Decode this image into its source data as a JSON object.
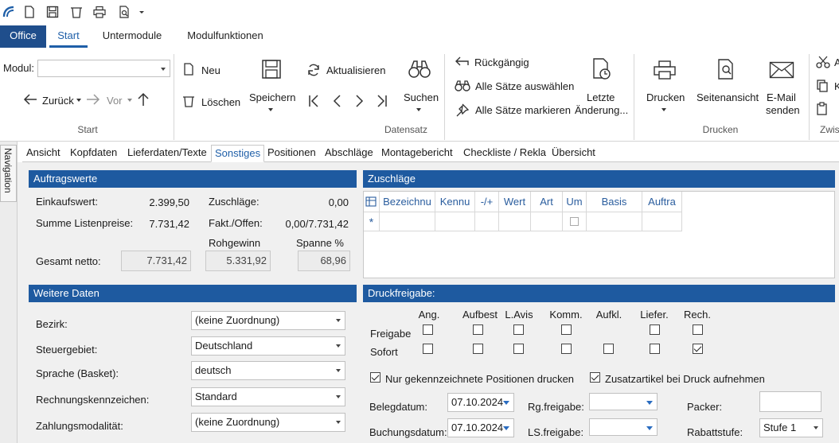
{
  "qat": {
    "icons": [
      "app-logo-icon",
      "new-document-icon",
      "save-icon",
      "delete-icon",
      "print-icon",
      "print-preview-icon",
      "dropdown-arrow-icon"
    ]
  },
  "tabs": {
    "office": "Office",
    "start": "Start",
    "untermodule": "Untermodule",
    "modulfunktionen": "Modulfunktionen"
  },
  "ribbon": {
    "modul_label": "Modul:",
    "zurueck": "Zurück",
    "vor": "Vor",
    "start_group": "Start",
    "neu": "Neu",
    "loeschen": "Löschen",
    "speichern": "Speichern",
    "aktualisieren": "Aktualisieren",
    "suchen": "Suchen",
    "rueckgaengig": "Rückgängig",
    "alle_auswaehlen": "Alle Sätze auswählen",
    "alle_markieren": "Alle Sätze markieren",
    "letzte_1": "Letzte",
    "letzte_2": "Änderung...",
    "datensatz_group": "Datensatz",
    "drucken": "Drucken",
    "seitenansicht": "Seitenansicht",
    "email_1": "E-Mail",
    "email_2": "senden",
    "drucken_group": "Drucken",
    "zwis_group": "Zwis",
    "cut_short": "A",
    "copy_short": "K"
  },
  "navigation": {
    "label": "Navigation"
  },
  "subtabs": [
    "Ansicht",
    "Kopfdaten",
    "Lieferdaten/Texte",
    "Sonstiges",
    "Positionen",
    "Abschläge",
    "Montagebericht",
    "Checkliste / Rekla",
    "Übersicht"
  ],
  "auftragswerte": {
    "title": "Auftragswerte",
    "einkaufswert_label": "Einkaufswert:",
    "einkaufswert": "2.399,50",
    "summe_label": "Summe Listenpreise:",
    "summe": "7.731,42",
    "zuschlaege_label": "Zuschläge:",
    "zuschlaege": "0,00",
    "fakt_label": "Fakt./Offen:",
    "fakt": "0,00/7.731,42",
    "rohgewinn_label": "Rohgewinn",
    "spanne_label": "Spanne %",
    "gesamt_label": "Gesamt netto:",
    "gesamt": "7.731,42",
    "rohgewinn": "5.331,92",
    "spanne": "68,96"
  },
  "zuschlaege": {
    "title": "Zuschläge",
    "columns": [
      "Bezeichnu",
      "Kennu",
      "-/+",
      "Wert",
      "Art",
      "Um",
      "Basis",
      "Auftra"
    ],
    "new_row_marker": "*"
  },
  "weitere": {
    "title": "Weitere Daten",
    "rows": [
      {
        "label": "Bezirk:",
        "value": "(keine Zuordnung)"
      },
      {
        "label": "Steuergebiet:",
        "value": "Deutschland"
      },
      {
        "label": "Sprache (Basket):",
        "value": "deutsch"
      },
      {
        "label": "Rechnungskennzeichen:",
        "value": "Standard"
      },
      {
        "label": "Zahlungsmodalität:",
        "value": "(keine Zuordnung)"
      }
    ]
  },
  "druck": {
    "title": "Druckfreigabe:",
    "columns": [
      "Ang.",
      "Aufbest",
      "L.Avis",
      "Komm.",
      "Aufkl.",
      "Liefer.",
      "Rech."
    ],
    "freigabe_label": "Freigabe",
    "sofort_label": "Sofort",
    "nur_gekennzeichnete": "Nur gekennzeichnete Positionen drucken",
    "zusatzartikel": "Zusatzartikel bei Druck aufnehmen",
    "belegdatum_label": "Belegdatum:",
    "belegdatum": "07.10.2024",
    "buchungsdatum_label": "Buchungsdatum:",
    "buchungsdatum": "07.10.2024",
    "rgfreigabe_label": "Rg.freigabe:",
    "lsfreigabe_label": "LS.freigabe:",
    "packer_label": "Packer:",
    "rabattstufe_label": "Rabattstufe:",
    "rabattstufe": "Stufe 1"
  },
  "colors": {
    "accent": "#1e5aa0",
    "office_tab": "#1f4e8c",
    "panel_bg": "#f0f0f0"
  }
}
